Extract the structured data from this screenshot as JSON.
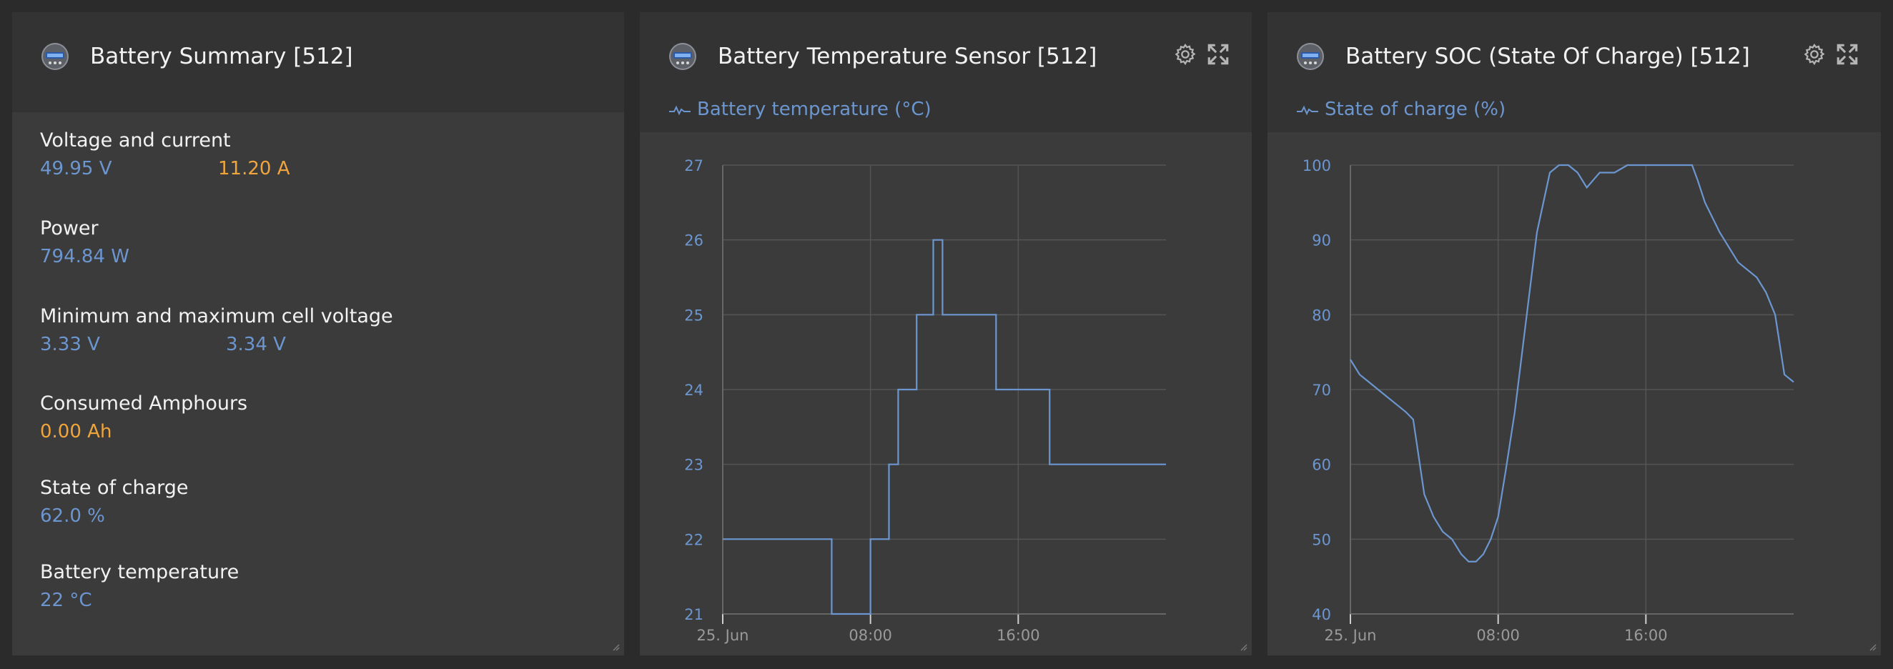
{
  "summary": {
    "title": "Battery Summary [512]",
    "fields": [
      {
        "label": "Voltage and current",
        "values": [
          "49.95 V",
          "11.20 A"
        ]
      },
      {
        "label": "Power",
        "values": [
          "794.84 W"
        ]
      },
      {
        "label": "Minimum and maximum cell voltage",
        "values": [
          "3.33 V",
          "3.34 V"
        ]
      },
      {
        "label": "Consumed Amphours",
        "values": [
          "0.00 Ah"
        ]
      },
      {
        "label": "State of charge",
        "values": [
          "62.0 %"
        ]
      },
      {
        "label": "Battery temperature",
        "values": [
          "22 °C"
        ]
      }
    ]
  },
  "temp_panel": {
    "title": "Battery Temperature Sensor [512]",
    "legend": "Battery temperature (°C)"
  },
  "soc_panel": {
    "title": "Battery SOC (State Of Charge) [512]",
    "legend": "State of charge (%)"
  },
  "colors": {
    "accent_blue": "#6c96d0",
    "accent_orange": "#f0a53c",
    "panel_bg": "#3b3b3b",
    "header_bg": "#333333"
  },
  "icons": [
    "battery-device-icon",
    "gear-icon",
    "expand-icon",
    "resize-grip-icon"
  ],
  "chart_data": [
    {
      "type": "line",
      "ylim": [
        21,
        27
      ],
      "yticks": [
        21,
        22,
        23,
        24,
        25,
        26,
        27
      ],
      "xlim": [
        0,
        24
      ],
      "xticks": [
        0,
        8,
        16
      ],
      "xtick_labels": [
        "25. Jun",
        "08:00",
        "16:00"
      ],
      "grid": true,
      "series": [
        {
          "name": "Battery temperature (°C)",
          "step": true,
          "x": [
            0,
            5.9,
            8.0,
            8.2,
            9.0,
            9.5,
            9.7,
            10.5,
            11.4,
            11.9,
            12.8,
            14.8,
            17.7,
            24
          ],
          "y": [
            22,
            21,
            22,
            22,
            23,
            24,
            24,
            25,
            26,
            25,
            25,
            24,
            23,
            23
          ]
        }
      ]
    },
    {
      "type": "line",
      "ylim": [
        40,
        100
      ],
      "yticks": [
        40,
        50,
        60,
        70,
        80,
        90,
        100
      ],
      "xlim": [
        0,
        24
      ],
      "xticks": [
        0,
        8,
        16
      ],
      "xtick_labels": [
        "25. Jun",
        "08:00",
        "16:00"
      ],
      "grid": true,
      "series": [
        {
          "name": "State of charge (%)",
          "x": [
            0,
            0.5,
            1.0,
            1.5,
            2.0,
            2.5,
            3.0,
            3.4,
            3.7,
            4.0,
            4.5,
            5.0,
            5.5,
            6.0,
            6.4,
            6.8,
            7.2,
            7.6,
            8.0,
            8.4,
            8.9,
            9.5,
            10.1,
            10.8,
            11.3,
            11.8,
            12.3,
            12.8,
            13.5,
            14.3,
            15.0,
            15.5,
            16.0,
            16.8,
            17.6,
            18.5,
            18.8,
            19.2,
            19.6,
            20.0,
            20.5,
            21.0,
            21.5,
            22.0,
            22.5,
            23.0,
            23.5,
            24.0
          ],
          "y": [
            74,
            72,
            71,
            70,
            69,
            68,
            67,
            66,
            61,
            56,
            53,
            51,
            50,
            48,
            47,
            47,
            48,
            50,
            53,
            59,
            67,
            79,
            91,
            99,
            100,
            100,
            99,
            97,
            99,
            99,
            100,
            100,
            100,
            100,
            100,
            100,
            98,
            95,
            93,
            91,
            89,
            87,
            86,
            85,
            83,
            80,
            72,
            71
          ]
        }
      ]
    }
  ]
}
